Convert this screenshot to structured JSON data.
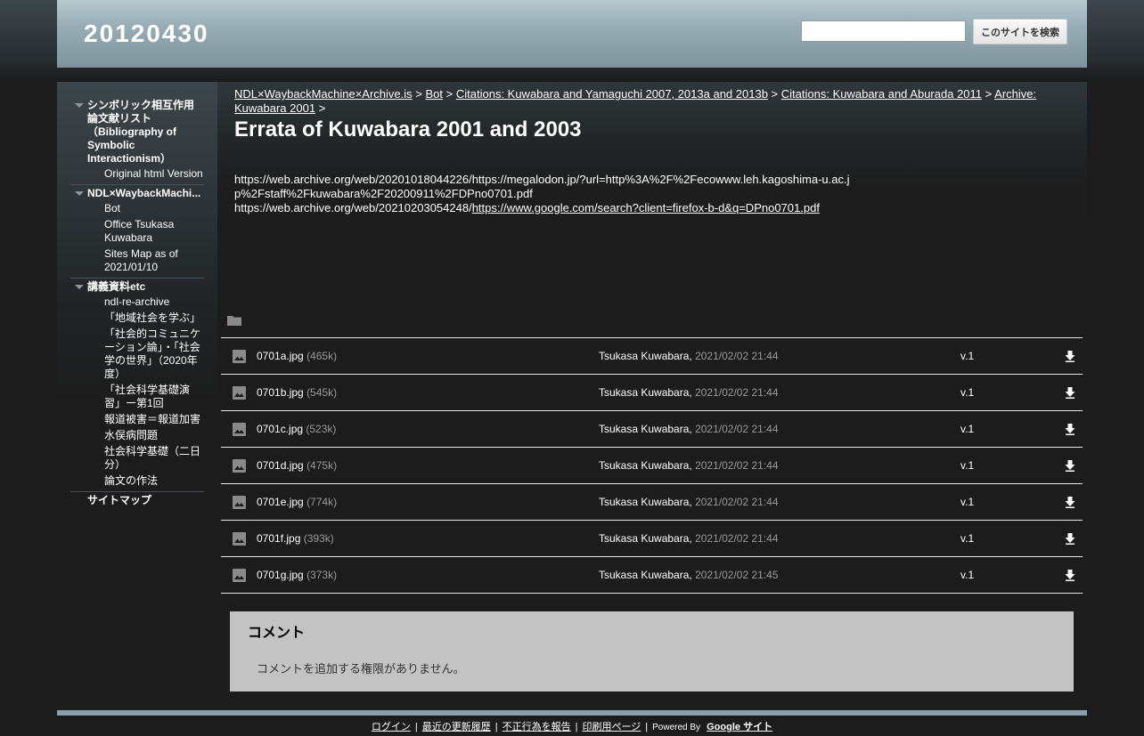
{
  "header": {
    "site_title": "20120430",
    "search_placeholder": "",
    "search_button": "このサイトを検索"
  },
  "sidebar": {
    "sections": [
      {
        "label": "シンボリック相互作用論文献リスト（Bibliography of Symbolic Interactionism）",
        "items": [
          "Original html Version"
        ]
      },
      {
        "label": "NDL×WaybackMachi...",
        "items": [
          "Bot",
          "Office Tsukasa Kuwabara",
          "Sites Map as of 2021/01/10"
        ]
      },
      {
        "label": "講義資料etc",
        "items": [
          "ndl-re-archive",
          "「地域社会を学ぶ」",
          "「社会的コミュニケーション論」・「社会学の世界」（2020年度）",
          "「社会科学基礎演習」ー第1回",
          "報道被害＝報道加害",
          "水俣病問題",
          "社会科学基礎（二日分）",
          "論文の作法"
        ]
      }
    ],
    "sitemap": "サイトマップ"
  },
  "breadcrumb": {
    "items": [
      "NDL×WaybackMachine×Archive.is",
      "Bot",
      "Citations: Kuwabara and Yamaguchi 2007, 2013a and 2013b",
      "Citations: Kuwabara and Aburada 2011",
      "Archive: Kuwabara 2001"
    ],
    "separator": ">"
  },
  "page": {
    "title": "Errata of Kuwabara 2001 and 2003",
    "line1": "https://web.archive.org/web/20201018044226/https://megalodon.jp/?url=http%3A%2F%2Fecowww.leh.kagoshima-u.ac.jp%2Fstaff%2Fkuwabara%2F20200911%2FDPno0701.pdf",
    "line2_prefix": "https://web.archive.org/web/20210203054248/",
    "line2_link": "https://www.google.com/search?client=firefox-b-d&q=DPno0701.pdf"
  },
  "files": [
    {
      "name": "0701a.jpg",
      "size": "(465k)",
      "author": "Tsukasa Kuwabara,",
      "date": "2021/02/02 21:44",
      "version": "v.1"
    },
    {
      "name": "0701b.jpg",
      "size": "(545k)",
      "author": "Tsukasa Kuwabara,",
      "date": "2021/02/02 21:44",
      "version": "v.1"
    },
    {
      "name": "0701c.jpg",
      "size": "(523k)",
      "author": "Tsukasa Kuwabara,",
      "date": "2021/02/02 21:44",
      "version": "v.1"
    },
    {
      "name": "0701d.jpg",
      "size": "(475k)",
      "author": "Tsukasa Kuwabara,",
      "date": "2021/02/02 21:44",
      "version": "v.1"
    },
    {
      "name": "0701e.jpg",
      "size": "(774k)",
      "author": "Tsukasa Kuwabara,",
      "date": "2021/02/02 21:44",
      "version": "v.1"
    },
    {
      "name": "0701f.jpg",
      "size": "(393k)",
      "author": "Tsukasa Kuwabara,",
      "date": "2021/02/02 21:44",
      "version": "v.1"
    },
    {
      "name": "0701g.jpg",
      "size": "(373k)",
      "author": "Tsukasa Kuwabara,",
      "date": "2021/02/02 21:45",
      "version": "v.1"
    }
  ],
  "comments": {
    "title": "コメント",
    "message": "コメントを追加する権限がありません。"
  },
  "footer": {
    "login": "ログイン",
    "recent": "最近の更新履歴",
    "report": "不正行為を報告",
    "print": "印刷用ページ",
    "powered_by": "Powered By",
    "google_sites": "Google サイト"
  },
  "icons": {
    "folder": "folder-icon",
    "image": "image-icon",
    "download": "download-icon",
    "expand": "triangle-down-icon"
  },
  "colors": {
    "background": "#1c1c1c",
    "header": "#97adb6",
    "comments_bg": "#c3c3c3",
    "muted_text": "#999999"
  }
}
